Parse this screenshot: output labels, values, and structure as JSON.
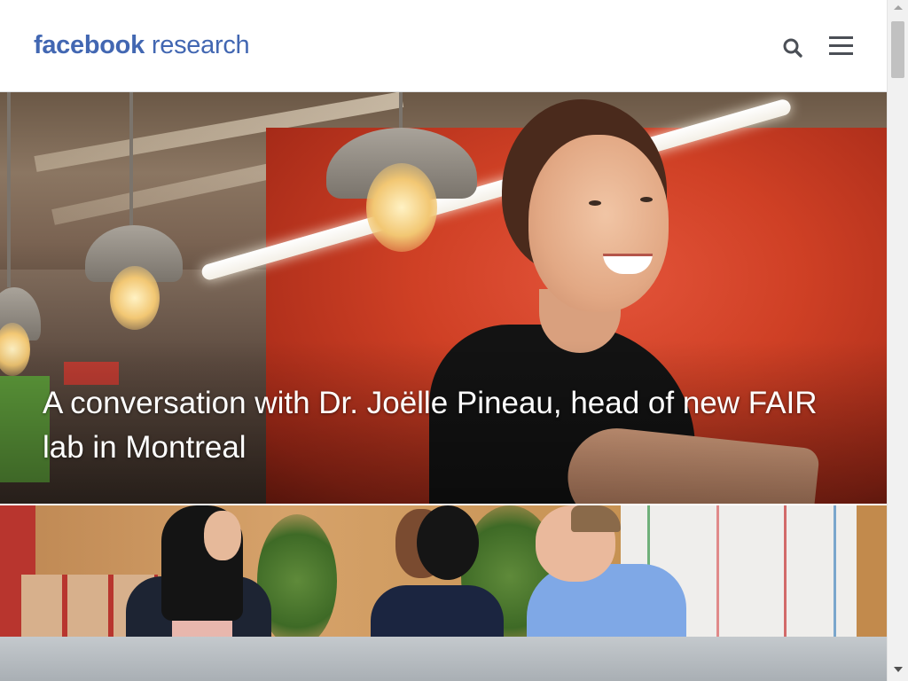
{
  "header": {
    "logo": {
      "brand": "facebook",
      "suffix": "research"
    },
    "search_icon": "search-icon",
    "menu_icon": "hamburger-menu-icon"
  },
  "hero": {
    "title": "A conversation with Dr. Joëlle Pineau, head of new FAIR lab in Montreal"
  },
  "colors": {
    "brand_blue": "#4267b2",
    "icon_gray": "#4b4f56",
    "header_bg": "#ffffff"
  }
}
